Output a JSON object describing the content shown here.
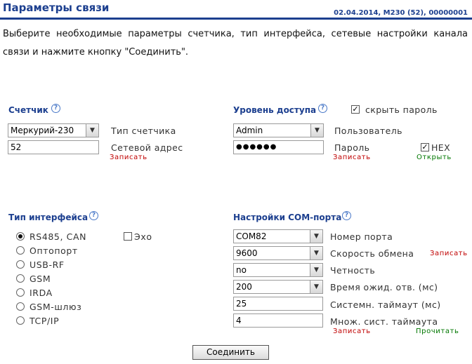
{
  "header": {
    "title": "Параметры связи",
    "meta": "02.04.2014, M230 (52), 00000001"
  },
  "description": "Выберите необходимые параметры счетчика, тип интерфейса, сетевые настройки канала связи и нажмите кнопку \"Соединить\".",
  "counter": {
    "title": "Счетчик",
    "help": "?",
    "type_value": "Меркурий-230",
    "type_label": "Тип счетчика",
    "address_value": "52",
    "address_label": "Сетевой адрес",
    "write_label": "Записать"
  },
  "access": {
    "title": "Уровень доступа",
    "help": "?",
    "hide_password_label": "скрыть пароль",
    "hide_password_checked": "✓",
    "user_value": "Admin",
    "user_label": "Пользователь",
    "password_value": "●●●●●●",
    "password_label": "Пароль",
    "hex_label": "HEX",
    "hex_checked": "✓",
    "write_label": "Записать",
    "open_label": "Открыть"
  },
  "interface": {
    "title": "Тип интерфейса",
    "help": "?",
    "options": [
      "RS485, CAN",
      "Оптопорт",
      "USB-RF",
      "GSM",
      "IRDA",
      "GSM-шлюз",
      "TCP/IP"
    ],
    "selected": "RS485, CAN",
    "echo_label": "Эхо"
  },
  "com": {
    "title": "Настройки COM-порта",
    "help": "?",
    "port_value": "COM82",
    "port_label": "Номер порта",
    "speed_value": "9600",
    "speed_label": "Скорость обмена",
    "speed_write": "Записать",
    "parity_value": "no",
    "parity_label": "Четность",
    "wait_value": "200",
    "wait_label": "Время ожид. отв. (мс)",
    "timeout_value": "25",
    "timeout_label": "Системн. таймаут (мс)",
    "mult_value": "4",
    "mult_label": "Множ. сист. таймаута",
    "write_label": "Записать",
    "read_label": "Прочитать"
  },
  "connect_button": "Соединить",
  "icons": {
    "dropdown": "chevron-down-icon",
    "help": "help-icon"
  }
}
